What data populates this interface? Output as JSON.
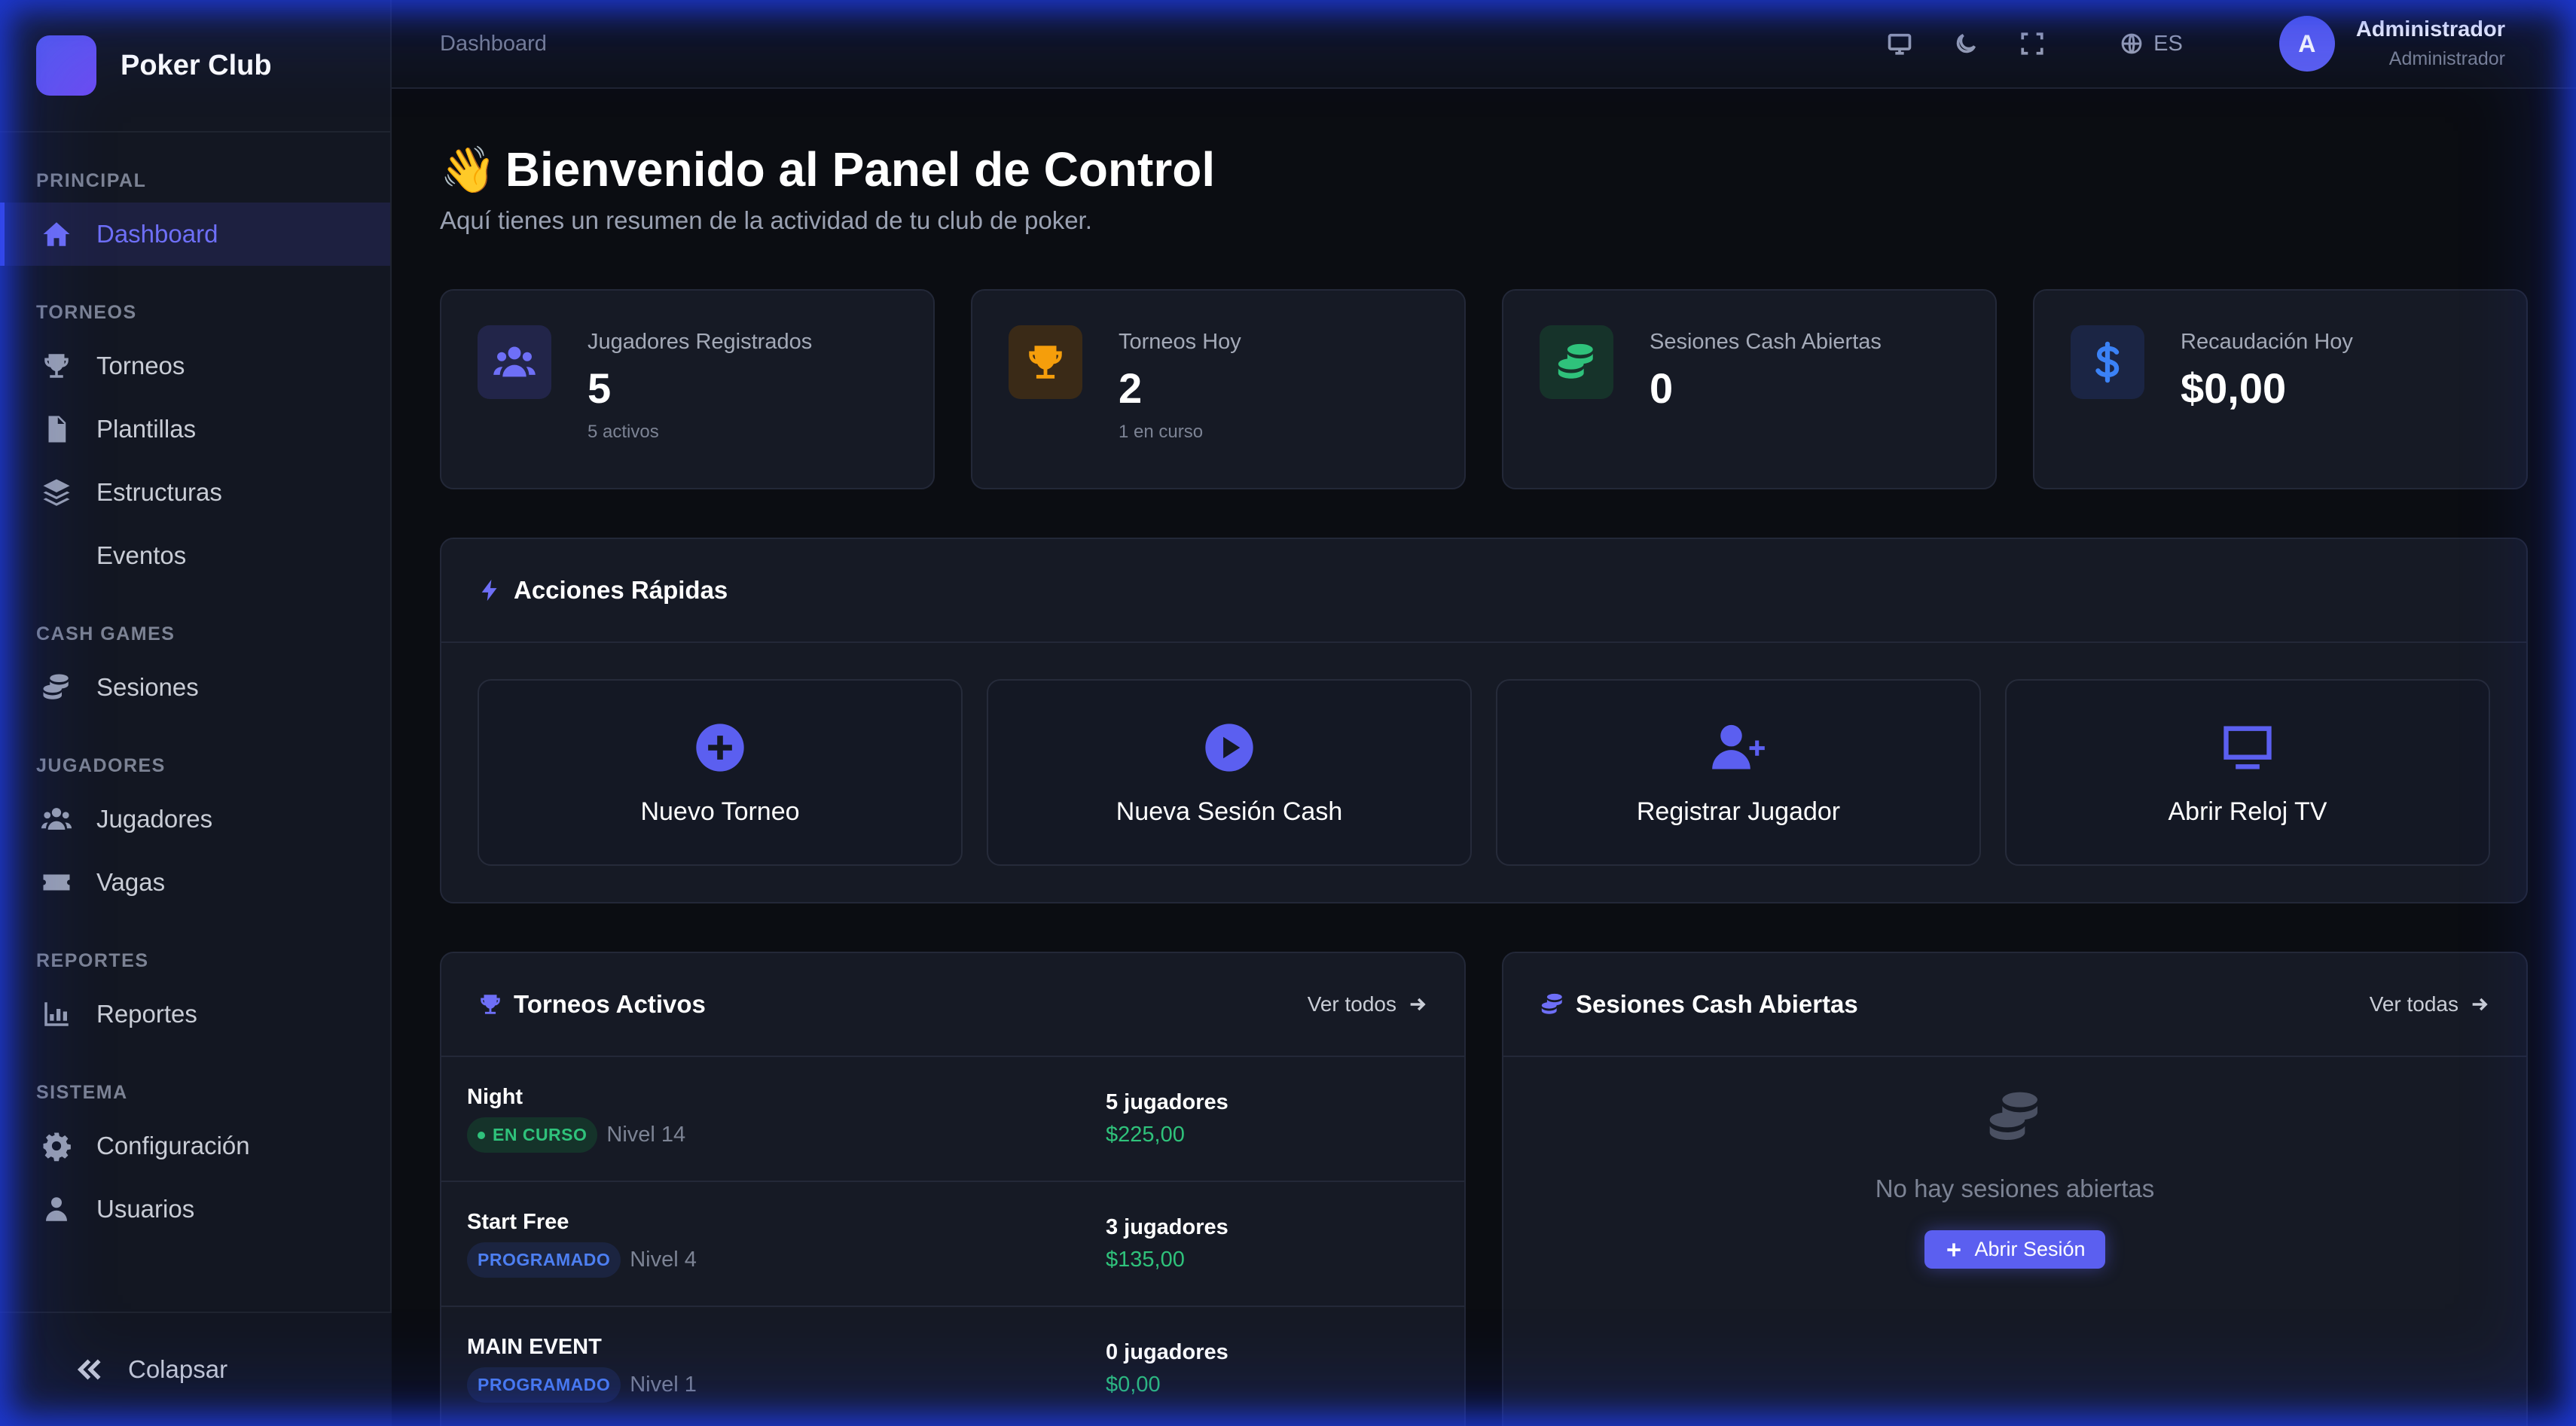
{
  "brand": {
    "name": "Poker Club"
  },
  "sidebar": {
    "sections": [
      {
        "title": "PRINCIPAL",
        "items": [
          {
            "label": "Dashboard",
            "icon": "home-icon",
            "active": true
          }
        ]
      },
      {
        "title": "TORNEOS",
        "items": [
          {
            "label": "Torneos",
            "icon": "trophy-icon"
          },
          {
            "label": "Plantillas",
            "icon": "file-icon"
          },
          {
            "label": "Estructuras",
            "icon": "layers-icon"
          },
          {
            "label": "Eventos",
            "icon": ""
          }
        ]
      },
      {
        "title": "CASH GAMES",
        "items": [
          {
            "label": "Sesiones",
            "icon": "coins-icon"
          }
        ]
      },
      {
        "title": "JUGADORES",
        "items": [
          {
            "label": "Jugadores",
            "icon": "users-icon"
          },
          {
            "label": "Vagas",
            "icon": "ticket-icon"
          }
        ]
      },
      {
        "title": "REPORTES",
        "items": [
          {
            "label": "Reportes",
            "icon": "chart-icon"
          }
        ]
      },
      {
        "title": "SISTEMA",
        "items": [
          {
            "label": "Configuración",
            "icon": "gear-icon"
          },
          {
            "label": "Usuarios",
            "icon": "user-icon"
          }
        ]
      }
    ],
    "collapse_label": "Colapsar"
  },
  "topbar": {
    "breadcrumb": "Dashboard",
    "language": "ES",
    "user": {
      "initial": "A",
      "name": "Administrador",
      "role": "Administrador"
    }
  },
  "welcome": {
    "emoji": "👋",
    "title": "Bienvenido al Panel de Control",
    "subtitle": "Aquí tienes un resumen de la actividad de tu club de poker."
  },
  "stats": [
    {
      "label": "Jugadores Registrados",
      "value": "5",
      "sub": "5 activos",
      "color": "#6e6ff7"
    },
    {
      "label": "Torneos Hoy",
      "value": "2",
      "sub": "1 en curso",
      "color": "#f59e0b"
    },
    {
      "label": "Sesiones Cash Abiertas",
      "value": "0",
      "sub": "",
      "color": "#2fc27b"
    },
    {
      "label": "Recaudación Hoy",
      "value": "$0,00",
      "sub": "",
      "color": "#3b82f6"
    }
  ],
  "quick": {
    "title": "Acciones Rápidas",
    "actions": [
      {
        "label": "Nuevo Torneo",
        "icon": "plus-circle-icon"
      },
      {
        "label": "Nueva Sesión Cash",
        "icon": "play-circle-icon"
      },
      {
        "label": "Registrar Jugador",
        "icon": "user-plus-icon"
      },
      {
        "label": "Abrir Reloj TV",
        "icon": "monitor-icon"
      }
    ]
  },
  "tournaments": {
    "title": "Torneos Activos",
    "link": "Ver todos",
    "rows": [
      {
        "name": "Night",
        "status": "EN CURSO",
        "status_type": "live",
        "level": "Nivel 14",
        "players": "5 jugadores",
        "prize": "$225,00"
      },
      {
        "name": "Start Free",
        "status": "PROGRAMADO",
        "status_type": "sched",
        "level": "Nivel 4",
        "players": "3 jugadores",
        "prize": "$135,00"
      },
      {
        "name": "MAIN EVENT",
        "status": "PROGRAMADO",
        "status_type": "sched",
        "level": "Nivel 1",
        "players": "0 jugadores",
        "prize": "$0,00"
      }
    ]
  },
  "sessions": {
    "title": "Sesiones Cash Abiertas",
    "link": "Ver todas",
    "empty_text": "No hay sesiones abiertas",
    "open_button": "Abrir Sesión"
  }
}
